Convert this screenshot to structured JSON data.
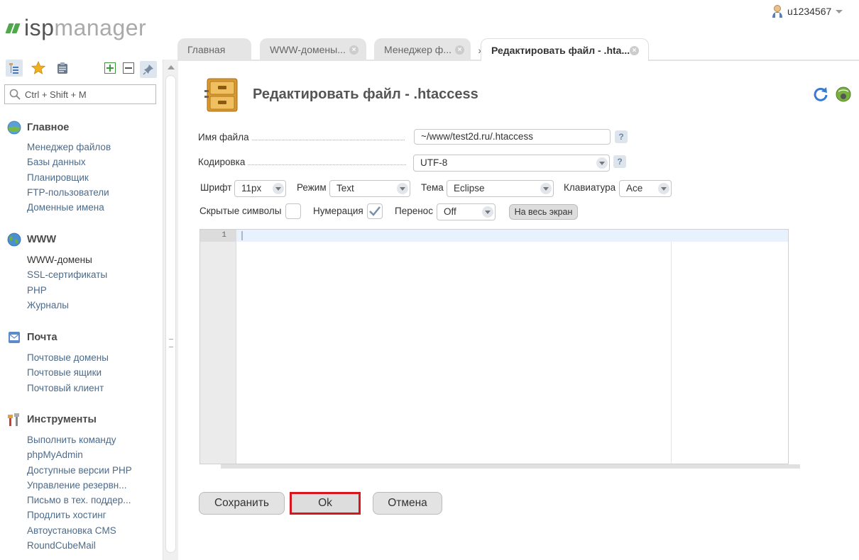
{
  "app": {
    "logo_isp": "isp",
    "logo_manager": "manager",
    "user_name": "u1234567"
  },
  "sidebar": {
    "search_placeholder": "Ctrl + Shift + M",
    "sections": [
      {
        "title": "Главное",
        "items": [
          "Менеджер файлов",
          "Базы данных",
          "Планировщик",
          "FTP-пользователи",
          "Доменные имена"
        ]
      },
      {
        "title": "WWW",
        "items": [
          "WWW-домены",
          "SSL-сертификаты",
          "PHP",
          "Журналы"
        ]
      },
      {
        "title": "Почта",
        "items": [
          "Почтовые домены",
          "Почтовые ящики",
          "Почтовый клиент"
        ]
      },
      {
        "title": "Инструменты",
        "items": [
          "Выполнить команду",
          "phpMyAdmin",
          "Доступные версии PHP",
          "Управление резервн...",
          "Письмо в тех. поддер...",
          "Продлить хостинг",
          "Автоустановка CMS",
          "RoundCubeMail"
        ]
      }
    ]
  },
  "tabs": [
    {
      "label": "Главная"
    },
    {
      "label": "WWW-домены..."
    },
    {
      "label": "Менеджер ф..."
    },
    {
      "label": "Редактировать файл - .hta..."
    }
  ],
  "form": {
    "title": "Редактировать файл - .htaccess",
    "filename_label": "Имя файла",
    "filename_value": "~/www/test2d.ru/.htaccess",
    "encoding_label": "Кодировка",
    "encoding_value": "UTF-8",
    "help": "?",
    "font_label": "Шрифт",
    "font_value": "11px",
    "mode_label": "Режим",
    "mode_value": "Text",
    "theme_label": "Тема",
    "theme_value": "Eclipse",
    "keyboard_label": "Клавиатура",
    "keyboard_value": "Ace",
    "hidden_chars_label": "Скрытые символы",
    "hidden_chars_checked": false,
    "numbering_label": "Нумерация",
    "numbering_checked": true,
    "wrap_label": "Перенос",
    "wrap_value": "Off",
    "fullscreen_label": "На весь экран",
    "line_number": "1"
  },
  "buttons": {
    "save": "Сохранить",
    "ok": "Ok",
    "cancel": "Отмена"
  },
  "colors": {
    "accent_red": "#d8161f",
    "logo_green": "#4fa84a",
    "link_blue": "#4c6b8a"
  }
}
